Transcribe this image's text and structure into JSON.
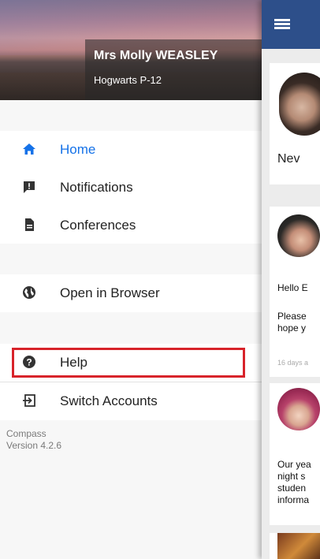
{
  "drawer": {
    "user_name": "Mrs Molly WEASLEY",
    "school": "Hogwarts P-12",
    "items": [
      {
        "label": "Home",
        "icon": "home-icon",
        "active": true
      },
      {
        "label": "Notifications",
        "icon": "notification-icon"
      },
      {
        "label": "Conferences",
        "icon": "document-icon"
      },
      {
        "label": "Open in Browser",
        "icon": "globe-icon"
      },
      {
        "label": "Help",
        "icon": "help-icon",
        "highlighted": true
      },
      {
        "label": "Switch Accounts",
        "icon": "switch-account-icon"
      }
    ],
    "footer_app": "Compass",
    "footer_version": "Version 4.2.6"
  },
  "colors": {
    "accent": "#1572e8",
    "topbar": "#2d4f8a",
    "highlight_border": "#d8232a"
  },
  "feed": {
    "card1_name": "Nev",
    "card2_line1": "Hello E",
    "card2_line2": "Please",
    "card2_line3": "hope y",
    "card2_time": "16 days a",
    "card3_line1": "Our yea",
    "card3_line2": "night s",
    "card3_line3": "studen",
    "card3_line4": "informa"
  }
}
